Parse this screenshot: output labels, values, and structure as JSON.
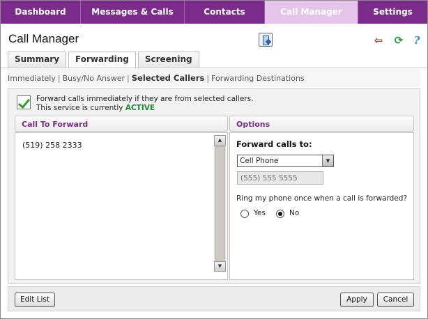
{
  "nav": {
    "items": [
      {
        "label": "Dashboard"
      },
      {
        "label": "Messages & Calls"
      },
      {
        "label": "Contacts"
      },
      {
        "label": "Call Manager"
      },
      {
        "label": "Settings"
      }
    ],
    "active": "Call Manager"
  },
  "header": {
    "title": "Call Manager",
    "icons": [
      "app-window-icon",
      "exit-icon",
      "refresh-icon",
      "help-icon"
    ],
    "help_glyph": "?"
  },
  "tabs": [
    {
      "label": "Summary"
    },
    {
      "label": "Forwarding"
    },
    {
      "label": "Screening"
    }
  ],
  "subnav": {
    "items": [
      {
        "label": "Immediately"
      },
      {
        "label": "Busy/No Answer"
      },
      {
        "label": "Selected Callers"
      },
      {
        "label": "Forwarding Destinations"
      }
    ],
    "separator": "|",
    "active": "Selected Callers"
  },
  "service": {
    "description": "Forward calls immediately if they are from selected callers.",
    "status_prefix": "This service is currently",
    "status": "ACTIVE",
    "enabled": true
  },
  "call_to_forward": {
    "heading": "Call To Forward",
    "numbers": [
      "(519) 258 2333"
    ]
  },
  "options": {
    "heading": "Options",
    "forward_label": "Forward calls to:",
    "forward_selected": "Cell Phone",
    "phone_placeholder": "(555) 555 5555",
    "ring_question": "Ring my phone once when a call is forwarded?",
    "ring_yes_label": "Yes",
    "ring_no_label": "No",
    "ring_selected": "No"
  },
  "footer": {
    "edit_label": "Edit List",
    "apply_label": "Apply",
    "cancel_label": "Cancel"
  },
  "colors": {
    "nav_bg": "#7b2c8a",
    "nav_active_bg": "#e6c5ea",
    "heading_text": "#7b2c8a",
    "active_status": "#1f8a2e"
  }
}
